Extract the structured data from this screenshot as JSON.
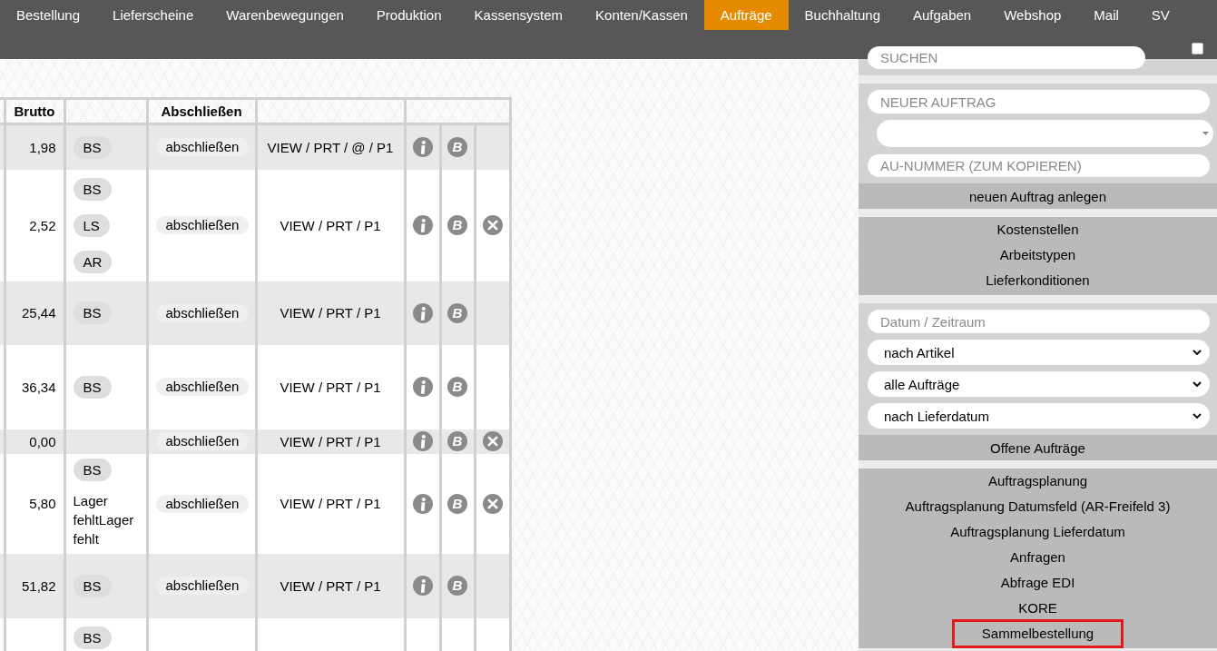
{
  "nav": {
    "tabs": [
      {
        "label": "Bestellung",
        "selected": false
      },
      {
        "label": "Lieferscheine",
        "selected": false
      },
      {
        "label": "Warenbewegungen",
        "selected": false
      },
      {
        "label": "Produktion",
        "selected": false
      },
      {
        "label": "Kassensystem",
        "selected": false
      },
      {
        "label": "Konten/Kassen",
        "selected": false
      },
      {
        "label": "Aufträge",
        "selected": true
      },
      {
        "label": "Buchhaltung",
        "selected": false
      },
      {
        "label": "Aufgaben",
        "selected": false
      },
      {
        "label": "Webshop",
        "selected": false
      },
      {
        "label": "Mail",
        "selected": false
      },
      {
        "label": "SV",
        "selected": false
      }
    ]
  },
  "table": {
    "headers": {
      "brutto": "Brutto",
      "close": "Abschließen"
    },
    "rows": [
      {
        "brutto": "1,98",
        "tags": [
          {
            "label": "BS"
          }
        ],
        "close": "abschließen",
        "links": "VIEW / PRT / @ / P1",
        "info": true,
        "b_label": "B",
        "deletable": false
      },
      {
        "brutto": "2,52",
        "tags": [
          {
            "label": "BS"
          },
          {
            "label": "LS"
          },
          {
            "label": "AR"
          }
        ],
        "close": "abschließen",
        "links": "VIEW / PRT / P1",
        "info": true,
        "b_label": "B",
        "deletable": true
      },
      {
        "brutto": "25,44",
        "tags": [
          {
            "label": "BS"
          }
        ],
        "close": "abschließen",
        "links": "VIEW / PRT / P1",
        "info": true,
        "b_label": "B",
        "deletable": false
      },
      {
        "brutto": "36,34",
        "tags": [
          {
            "label": "BS"
          }
        ],
        "close": "abschließen",
        "links": "VIEW / PRT / P1",
        "info": true,
        "b_label": "B",
        "deletable": false
      },
      {
        "brutto": "0,00",
        "close": "abschließen",
        "links": "VIEW / PRT / P1",
        "info": true,
        "b_label": "B",
        "deletable": true
      },
      {
        "brutto": "5,80",
        "tags": [
          {
            "label": "BS"
          }
        ],
        "note": "Lager fehltLager fehlt",
        "close": "abschließen",
        "links": "VIEW / PRT / P1",
        "info": true,
        "b_label": "B",
        "deletable": true
      },
      {
        "brutto": "51,82",
        "tags": [
          {
            "label": "BS"
          }
        ],
        "close": "abschließen",
        "links": "VIEW / PRT / P1",
        "info": true,
        "b_label": "B",
        "deletable": false
      },
      {
        "tags": [
          {
            "label": "BS"
          }
        ]
      }
    ]
  },
  "sidebar": {
    "search": {
      "placeholder": "SUCHEN"
    },
    "toggle": {
      "checked": false
    },
    "panels": [
      {
        "kind": "form",
        "fields": [
          {
            "kind": "input",
            "placeholder": "NEUER AUFTRAG"
          },
          {
            "kind": "combo"
          },
          {
            "kind": "input",
            "placeholder": "AU-NUMMER (ZUM KOPIEREN)"
          }
        ],
        "button": "neuen Auftrag anlegen"
      },
      {
        "kind": "menu",
        "items": [
          {
            "label": "Kostenstellen",
            "highlighted": false
          },
          {
            "label": "Arbeitstypen",
            "highlighted": false
          },
          {
            "label": "Lieferkonditionen",
            "highlighted": false
          }
        ]
      },
      {
        "kind": "form",
        "fields": [
          {
            "kind": "input",
            "placeholder": "Datum / Zeitraum"
          },
          {
            "kind": "select",
            "value": "nach Artikel"
          },
          {
            "kind": "select",
            "value": "alle Aufträge"
          },
          {
            "kind": "select",
            "value": "nach Lieferdatum"
          }
        ],
        "button": "Offene Aufträge"
      },
      {
        "kind": "menu",
        "items": [
          {
            "label": "Auftragsplanung",
            "highlighted": false
          },
          {
            "label": "Auftragsplanung Datumsfeld (AR-Freifeld 3)",
            "highlighted": false
          },
          {
            "label": "Auftragsplanung Lieferdatum",
            "highlighted": false
          },
          {
            "label": "Anfragen",
            "highlighted": false
          },
          {
            "label": "Abfrage EDI",
            "highlighted": false
          },
          {
            "label": "KORE",
            "highlighted": false
          },
          {
            "label": "Sammelbestellung",
            "highlighted": true
          }
        ]
      }
    ]
  }
}
